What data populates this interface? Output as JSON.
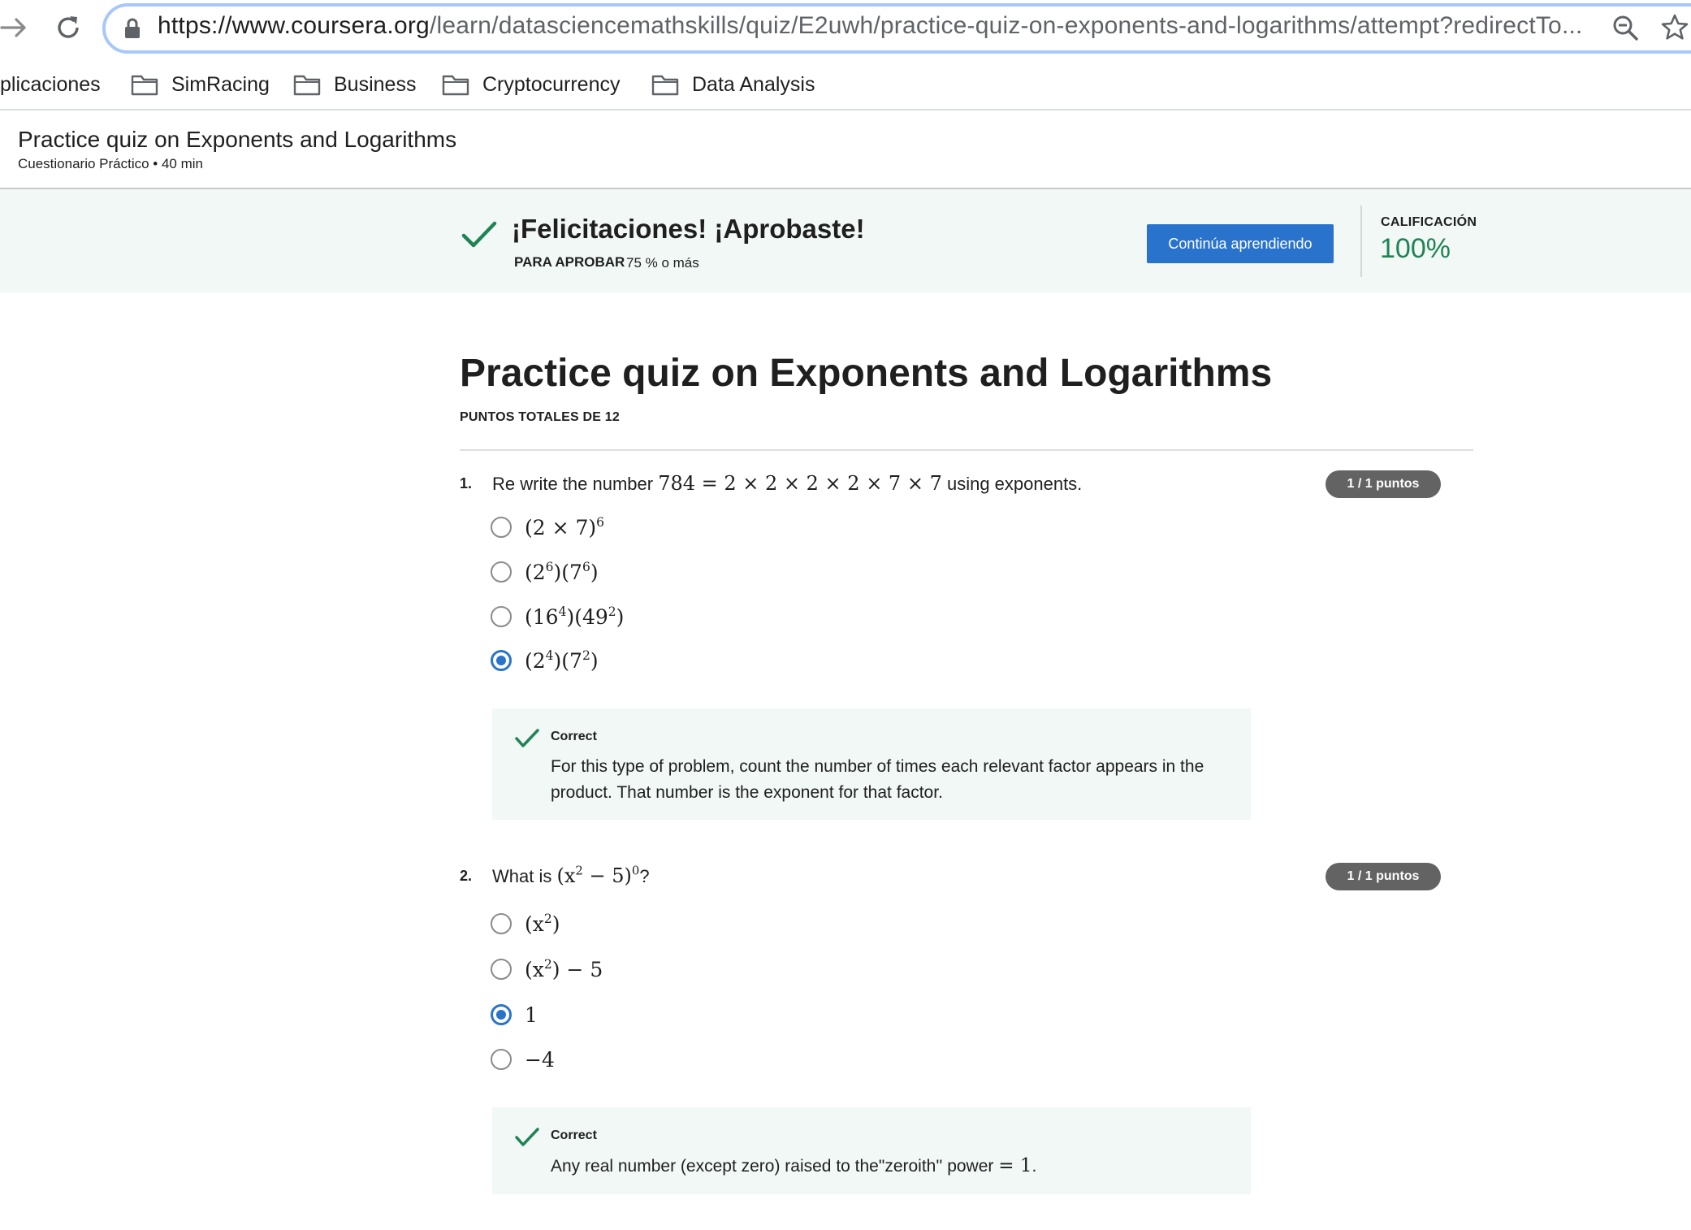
{
  "browser": {
    "url_host": "https://www.coursera.org",
    "url_path": "/learn/datasciencemathskills/quiz/E2uwh/practice-quiz-on-exponents-and-logarithms/attempt?redirectTo..."
  },
  "bookmarks": [
    {
      "label": "plicaciones",
      "icon": ""
    },
    {
      "label": "SimRacing",
      "icon": "folder-icon"
    },
    {
      "label": "Business",
      "icon": "folder-icon"
    },
    {
      "label": "Cryptocurrency",
      "icon": "folder-icon"
    },
    {
      "label": "Data Analysis",
      "icon": "folder-icon"
    }
  ],
  "course_header": {
    "title": "Practice quiz on Exponents and Logarithms",
    "subtitle": "Cuestionario Práctico • 40 min"
  },
  "banner": {
    "title": "¡Felicitaciones! ¡Aprobaste!",
    "pass_label": "PARA APROBAR",
    "pass_value": "75 % o más",
    "continue_button": "Continúa aprendiendo",
    "grade_label": "CALIFICACIÓN",
    "grade_value": "100%"
  },
  "quiz": {
    "title": "Practice quiz on Exponents and Logarithms",
    "total_points": "PUNTOS TOTALES DE 12",
    "questions": [
      {
        "number": "1.",
        "text_before": "Re write the number ",
        "text_math": "784 = 2 × 2 × 2 × 2 × 7 × 7",
        "text_after": " using exponents.",
        "points": "1 / 1 puntos",
        "options": [
          {
            "base": "(2 × 7)",
            "sup": "6",
            "tail": "",
            "selected": false
          },
          {
            "base": "(2",
            "sup": "6",
            "tail": ")(7",
            "sup2": "6",
            "tail2": ")",
            "selected": false
          },
          {
            "base": "(16",
            "sup": "4",
            "tail": ")(49",
            "sup2": "2",
            "tail2": ")",
            "selected": false
          },
          {
            "base": "(2",
            "sup": "4",
            "tail": ")(7",
            "sup2": "2",
            "tail2": ")",
            "selected": true
          }
        ],
        "feedback": {
          "title": "Correct",
          "text": "For this type of problem, count the number of times each relevant factor appears in the product. That number is the exponent for that factor."
        }
      },
      {
        "number": "2.",
        "text_before": "What is ",
        "text_math_a": "(x",
        "text_math_sup": "2",
        "text_math_b": " − 5)",
        "text_math_sup2": "0",
        "text_after": "?",
        "points": "1 / 1 puntos",
        "options": [
          {
            "base": "(x",
            "sup": "2",
            "tail": ")",
            "selected": false
          },
          {
            "base": "(x",
            "sup": "2",
            "tail": ") − 5",
            "selected": false
          },
          {
            "base": "1",
            "sup": "",
            "tail": "",
            "selected": true
          },
          {
            "base": "−4",
            "sup": "",
            "tail": "",
            "selected": false
          }
        ],
        "feedback": {
          "title": "Correct",
          "text_before": "Any real number (except zero) raised to the\"zeroith'' power ",
          "text_math": "= 1",
          "text_after": "."
        }
      }
    ]
  },
  "colors": {
    "accent_blue": "#2a73cc",
    "success_green": "#1f8354",
    "banner_bg": "#f2f8f5",
    "pill_gray": "#636363"
  }
}
